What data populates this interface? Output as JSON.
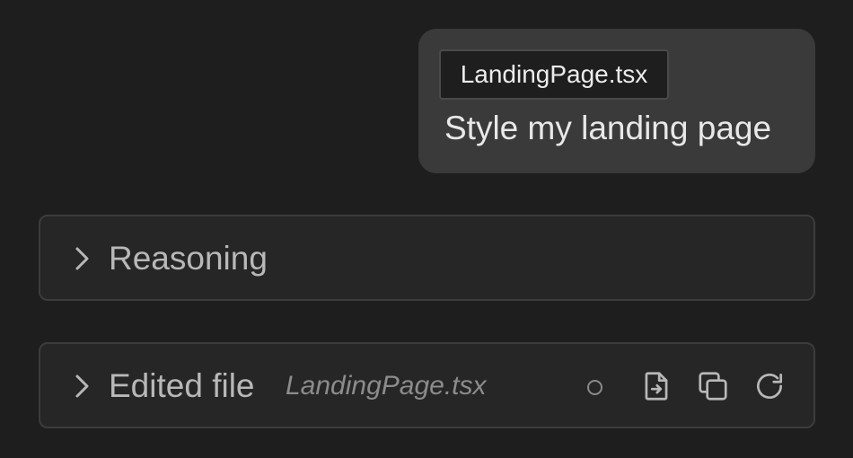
{
  "user_message": {
    "attachment": "LandingPage.tsx",
    "text": "Style my landing page"
  },
  "reasoning": {
    "label": "Reasoning",
    "icon": "chevron-right-icon"
  },
  "edited_file": {
    "label": "Edited file",
    "filename": "LandingPage.tsx",
    "status_icon": "status-dot-icon",
    "actions": [
      "apply-file-icon",
      "copy-icon",
      "refresh-icon"
    ]
  },
  "colors": {
    "background": "#1e1e1e",
    "bubble": "#3a3a3a",
    "row_background": "#262626",
    "row_border": "#3c3c3c"
  }
}
